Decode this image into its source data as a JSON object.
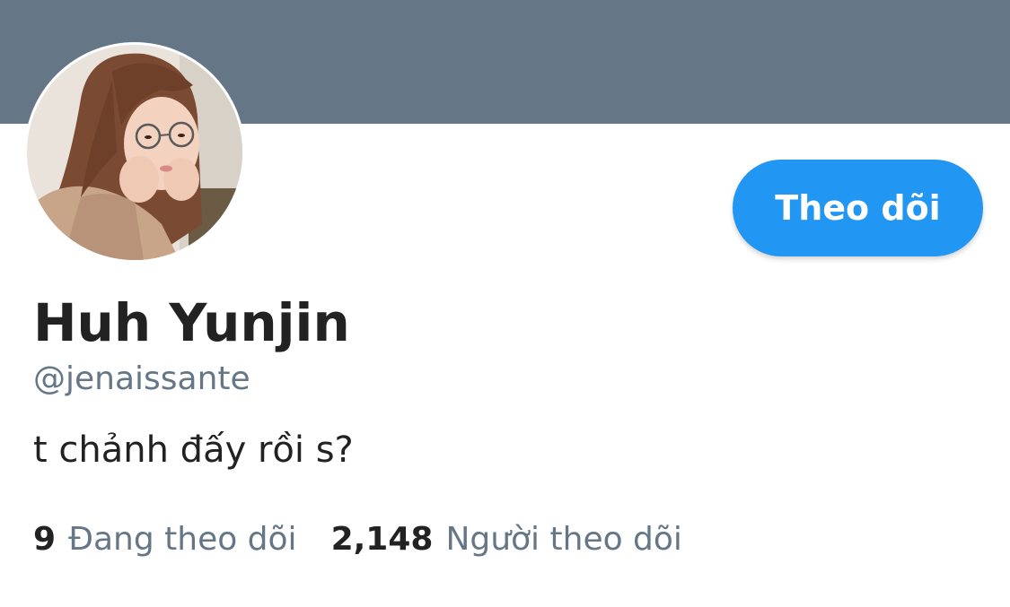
{
  "profile": {
    "display_name": "Huh Yunjin",
    "handle": "@jenaissante",
    "bio": "t chảnh đấy rồi s?",
    "follow_button_label": "Theo dõi",
    "banner_color": "#657786",
    "accent_color": "#2196f3"
  },
  "stats": {
    "following_count": "9",
    "following_label": "Đang theo dõi",
    "followers_count": "2,148",
    "followers_label": "Người theo dõi"
  }
}
